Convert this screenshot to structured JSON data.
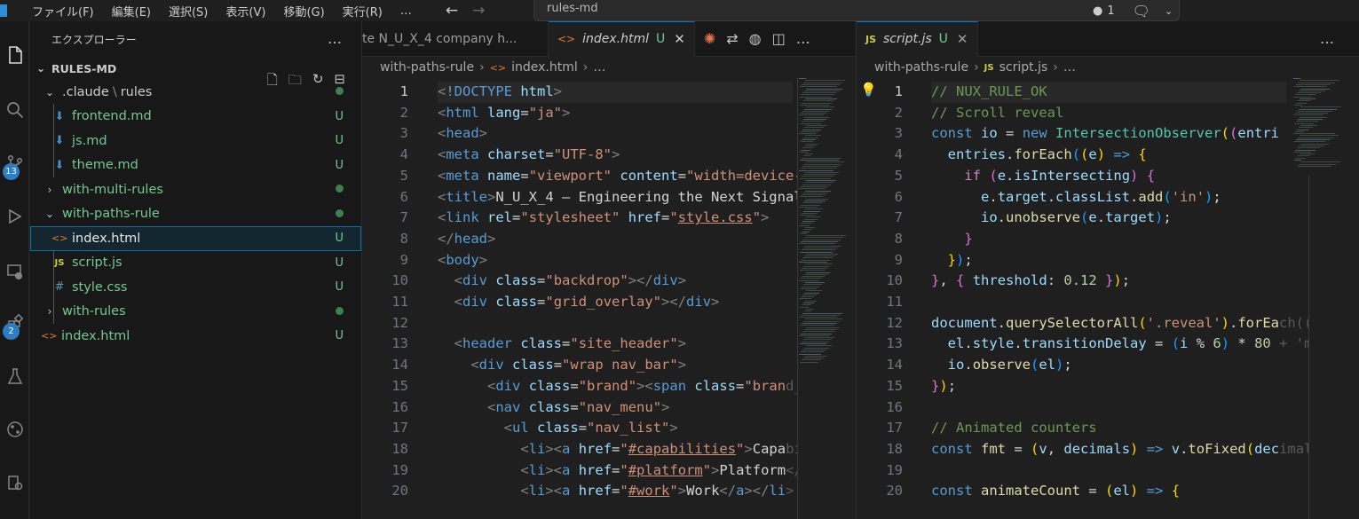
{
  "titlebar": {
    "menus": [
      "ファイル(F)",
      "編集(E)",
      "選択(S)",
      "表示(V)",
      "移動(G)",
      "実行(R)",
      "…"
    ],
    "search_text": "rules-md",
    "notifications": "1"
  },
  "activity_badges": {
    "scm": "13",
    "extensions": "2"
  },
  "explorer": {
    "title": "エクスプローラー",
    "more": "…",
    "root": "RULES-MD",
    "items": [
      {
        "label": ".claude",
        "label2": "rules",
        "icon": "",
        "status": "dot"
      },
      {
        "label": "frontend.md",
        "icon": "⬇",
        "status": "U"
      },
      {
        "label": "js.md",
        "icon": "⬇",
        "status": "U"
      },
      {
        "label": "theme.md",
        "icon": "⬇",
        "status": "U"
      },
      {
        "label": "with-multi-rules",
        "icon": "",
        "status": "dot"
      },
      {
        "label": "with-paths-rule",
        "icon": "",
        "status": "dot"
      },
      {
        "label": "index.html",
        "icon": "<>",
        "status": "U"
      },
      {
        "label": "script.js",
        "icon": "JS",
        "status": "U"
      },
      {
        "label": "style.css",
        "icon": "#",
        "status": "U"
      },
      {
        "label": "with-rules",
        "icon": "",
        "status": "dot"
      },
      {
        "label": "index.html",
        "icon": "<>",
        "status": "U"
      }
    ]
  },
  "editor_left": {
    "tab_inactive": "te N_U_X_4 company h...",
    "tab_active": "index.html",
    "tab_active_status": "U",
    "breadcrumb": [
      "with-paths-rule",
      "index.html",
      "…"
    ],
    "line_numbers": [
      "1",
      "2",
      "3",
      "4",
      "5",
      "6",
      "7",
      "8",
      "9",
      "10",
      "11",
      "12",
      "13",
      "14",
      "15",
      "16",
      "17",
      "18",
      "19",
      "20"
    ]
  },
  "editor_right": {
    "tab_active": "script.js",
    "tab_active_status": "U",
    "breadcrumb": [
      "with-paths-rule",
      "script.js",
      "…"
    ],
    "line_numbers": [
      "1",
      "2",
      "3",
      "4",
      "5",
      "6",
      "7",
      "8",
      "9",
      "10",
      "11",
      "12",
      "13",
      "14",
      "15",
      "16",
      "17",
      "18",
      "19",
      "20"
    ]
  },
  "colors": {
    "accent": "#0078d4",
    "untracked": "#73c991",
    "badge": "#2e7dc4"
  }
}
